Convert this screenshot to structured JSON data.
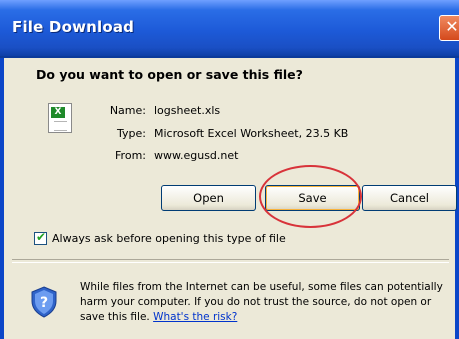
{
  "window": {
    "title": "File Download",
    "close_symbol": "✕"
  },
  "dialog": {
    "question": "Do you want to open or save this file?",
    "file_icon": "excel-file-icon",
    "file_icon_glyph": "X",
    "name_label": "Name:",
    "name_value": "logsheet.xls",
    "type_label": "Type:",
    "type_value": "Microsoft Excel Worksheet, 23.5 KB",
    "from_label": "From:",
    "from_value": "www.egusd.net",
    "buttons": {
      "open": "Open",
      "save": "Save",
      "cancel": "Cancel"
    },
    "always_ask": {
      "label": "Always ask before opening this type of file",
      "checked": true
    },
    "warning": {
      "icon": "shield-question-icon",
      "line1": "While files from the Internet can be useful, some files can potentially",
      "line2": "harm your computer. If you do not trust the source, do not open or",
      "line3": "save this file.",
      "link": "What's the risk?"
    }
  },
  "annotation": {
    "highlight_color": "#d8333a",
    "highlight_target": "save-button"
  },
  "colors": {
    "titlebar": "#1d5ad8",
    "dialog_bg": "#ece9d8",
    "button_border": "#003c74",
    "link": "#0033cc"
  }
}
